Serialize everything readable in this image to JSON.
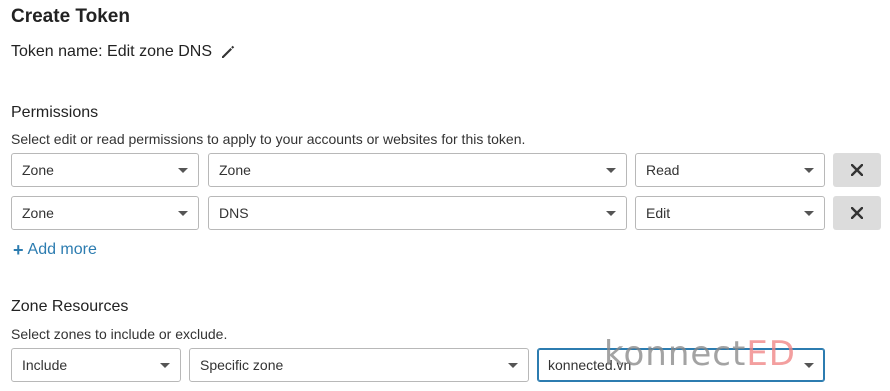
{
  "page": {
    "title": "Create Token",
    "token_name": "Token name: Edit zone DNS"
  },
  "permissions": {
    "heading": "Permissions",
    "description": "Select edit or read permissions to apply to your accounts or websites for this token.",
    "rows": [
      {
        "scope": "Zone",
        "resource": "Zone",
        "access": "Read"
      },
      {
        "scope": "Zone",
        "resource": "DNS",
        "access": "Edit"
      }
    ],
    "add_more_label": "Add more"
  },
  "zone_resources": {
    "heading": "Zone Resources",
    "description": "Select zones to include or exclude.",
    "include": "Include",
    "zone_type": "Specific zone",
    "zone_value": "konnected.vn"
  },
  "watermark": {
    "part1": "konnect",
    "part2": "ED"
  },
  "colors": {
    "link": "#2c7cb0",
    "focus_border": "#2c7cb0",
    "remove_button_bg": "#dcdcdc"
  },
  "icons": {
    "edit": "pencil-icon",
    "remove": "close-icon",
    "dropdown": "chevron-down-icon",
    "add": "plus-icon"
  }
}
